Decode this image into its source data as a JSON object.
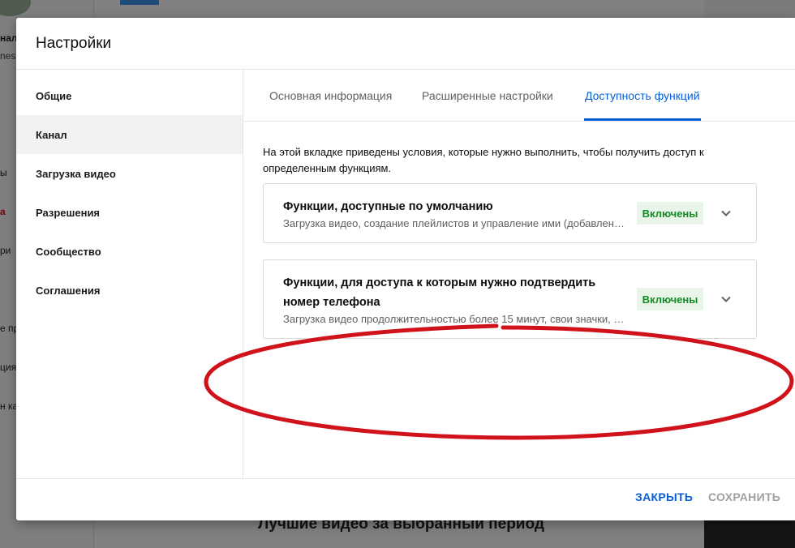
{
  "background": {
    "left_fragments": [
      "нал",
      "nes",
      "ы",
      "а",
      "ри",
      "е пр",
      "ция",
      "н ка"
    ],
    "heading": "Лучшие видео за выбранный период"
  },
  "dialog": {
    "title": "Настройки",
    "sidebar": {
      "items": [
        {
          "label": "Общие",
          "active": false
        },
        {
          "label": "Канал",
          "active": true
        },
        {
          "label": "Загрузка видео",
          "active": false
        },
        {
          "label": "Разрешения",
          "active": false
        },
        {
          "label": "Сообщество",
          "active": false
        },
        {
          "label": "Соглашения",
          "active": false
        }
      ]
    },
    "tabs": [
      {
        "label": "Основная информация",
        "active": false
      },
      {
        "label": "Расширенные настройки",
        "active": false
      },
      {
        "label": "Доступность функций",
        "active": true
      }
    ],
    "intro": "На этой вкладке приведены условия, которые нужно выполнить, чтобы получить доступ к определенным функциям.",
    "cards": [
      {
        "title": "Функции, доступные по умолчанию",
        "description": "Загрузка видео, создание плейлистов и управление ими (добавлен…",
        "status": "Включены"
      },
      {
        "title": "Функции, для доступа к которым нужно подтвердить номер телефона",
        "description": "Загрузка видео продолжительностью более 15 минут, свои значки, …",
        "status": "Включены"
      }
    ],
    "footer": {
      "close_label": "ЗАКРЫТЬ",
      "save_label": "СОХРАНИТЬ"
    }
  },
  "colors": {
    "accent": "#065fd4",
    "status_green": "#138a24",
    "status_bg": "#eaf5ea",
    "annotation": "#d0121b"
  },
  "icons": {
    "expand": "chevron-down-icon"
  }
}
